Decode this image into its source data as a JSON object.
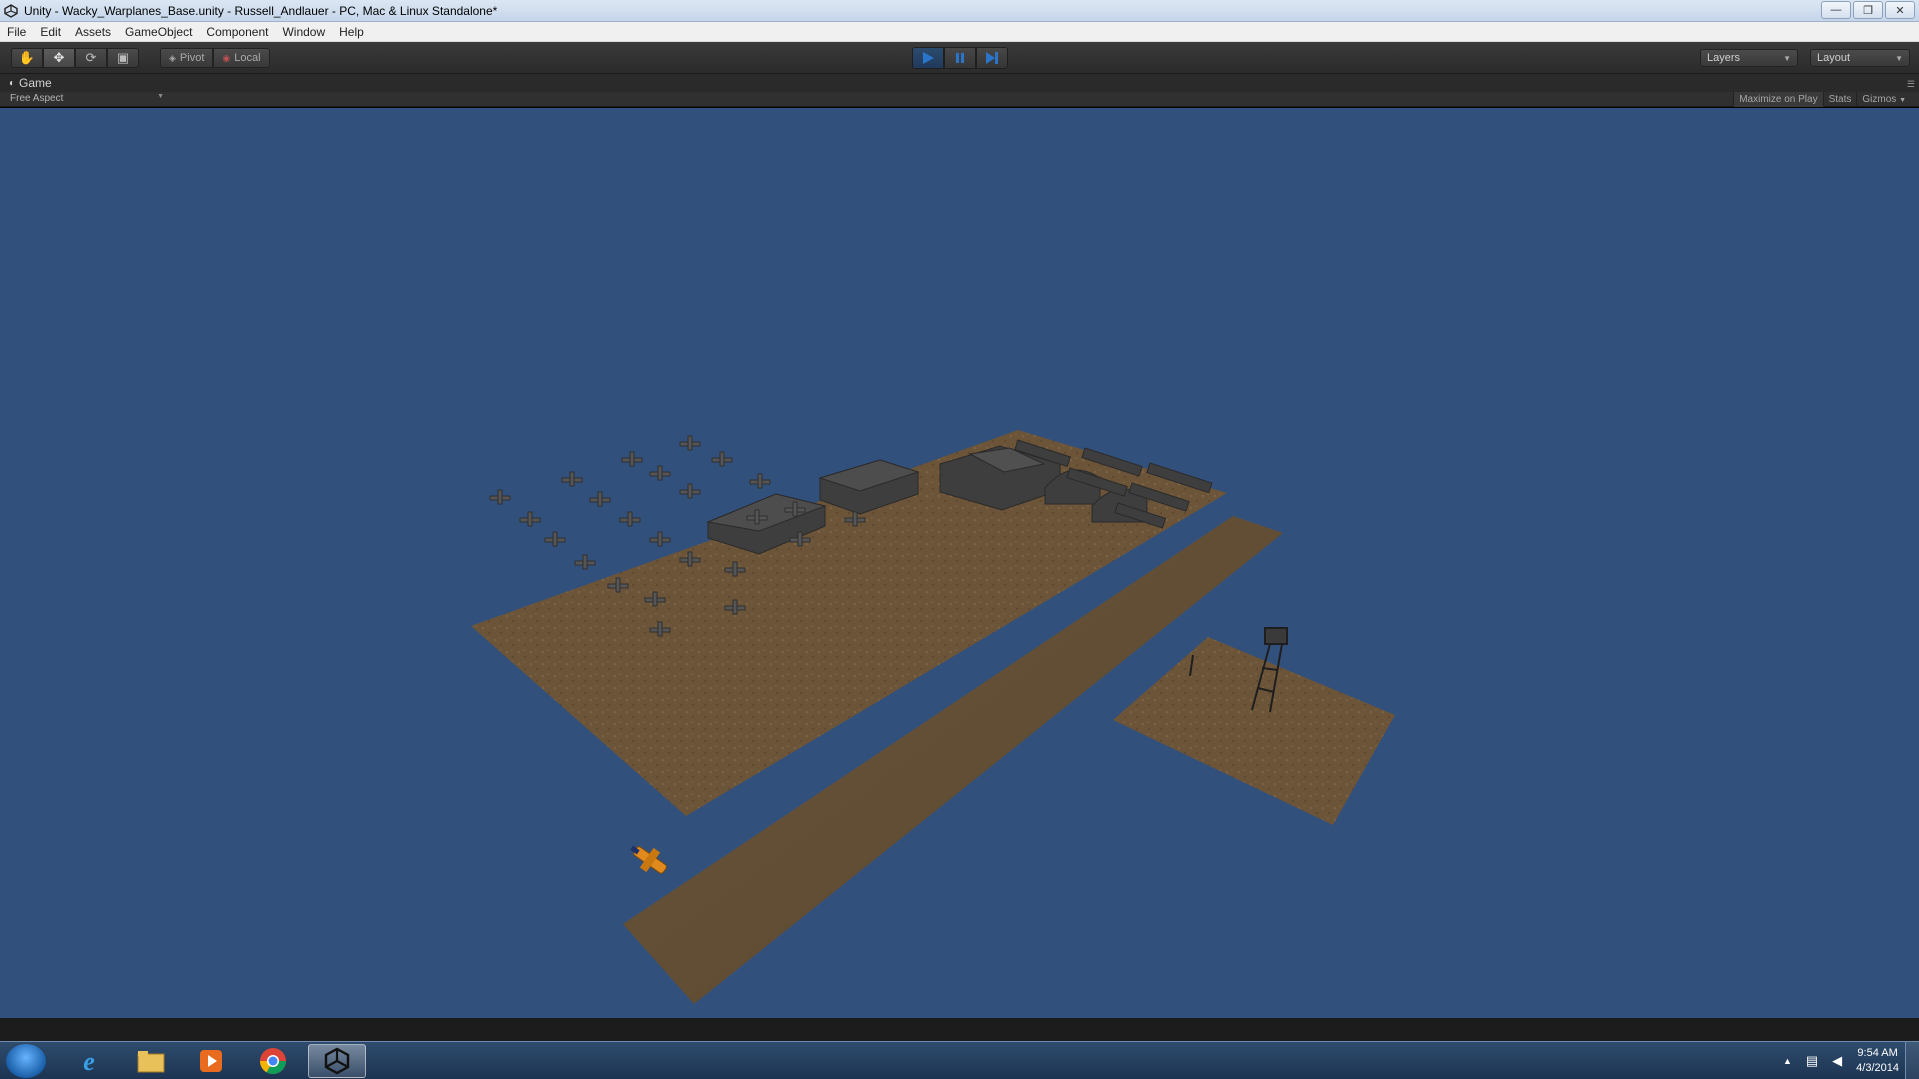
{
  "window": {
    "title": "Unity - Wacky_Warplanes_Base.unity - Russell_Andlauer - PC, Mac & Linux Standalone*",
    "controls": [
      "minimize-icon",
      "restore-icon",
      "close-icon"
    ]
  },
  "menu": [
    "File",
    "Edit",
    "Assets",
    "GameObject",
    "Component",
    "Window",
    "Help"
  ],
  "toolbar": {
    "transform_tools": [
      "hand-icon",
      "move-icon",
      "rotate-icon",
      "scale-icon"
    ],
    "pivot_label": "Pivot",
    "local_label": "Local",
    "playback": [
      "play-icon",
      "pause-icon",
      "step-icon"
    ],
    "layers_label": "Layers",
    "layout_label": "Layout"
  },
  "game_panel": {
    "tab_label": "Game",
    "aspect": "Free Aspect",
    "maximize_label": "Maximize on Play",
    "stats_label": "Stats",
    "gizmos_label": "Gizmos"
  },
  "colors": {
    "sky": "#32507c",
    "ground": "#6b5438",
    "runway": "#5e4b33",
    "buildings": "#3f3f3f",
    "plane_player": "#e08a1e",
    "play_active": "#2a74c9"
  },
  "taskbar": {
    "icons": [
      "start-orb-icon",
      "internet-explorer-icon",
      "file-explorer-icon",
      "media-player-icon",
      "chrome-icon",
      "unity-icon"
    ],
    "time": "9:54 AM",
    "date": "4/3/2014"
  }
}
